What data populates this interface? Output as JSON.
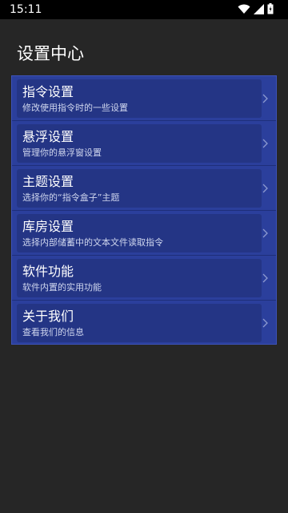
{
  "status_bar": {
    "time": "15:11",
    "icons": [
      "wifi-icon",
      "signal-icon",
      "battery-icon"
    ]
  },
  "header": {
    "title": "设置中心"
  },
  "menu": {
    "items": [
      {
        "title": "指令设置",
        "subtitle": "修改使用指令时的一些设置",
        "icon": "chevron-right-icon"
      },
      {
        "title": "悬浮设置",
        "subtitle": "管理你的悬浮窗设置",
        "icon": "chevron-right-icon"
      },
      {
        "title": "主题设置",
        "subtitle": "选择你的“指令盒子”主题",
        "icon": "chevron-right-icon"
      },
      {
        "title": "库房设置",
        "subtitle": "选择内部储蓄中的文本文件读取指令",
        "icon": "chevron-right-icon"
      },
      {
        "title": "软件功能",
        "subtitle": "软件内置的实用功能",
        "icon": "chevron-right-icon"
      },
      {
        "title": "关于我们",
        "subtitle": "查看我们的信息",
        "icon": "chevron-right-icon"
      }
    ]
  },
  "colors": {
    "background": "#262626",
    "status_bar": "#000000",
    "menu_panel": "#2b3f9c",
    "subtitle_text": "#cfd6ee"
  }
}
